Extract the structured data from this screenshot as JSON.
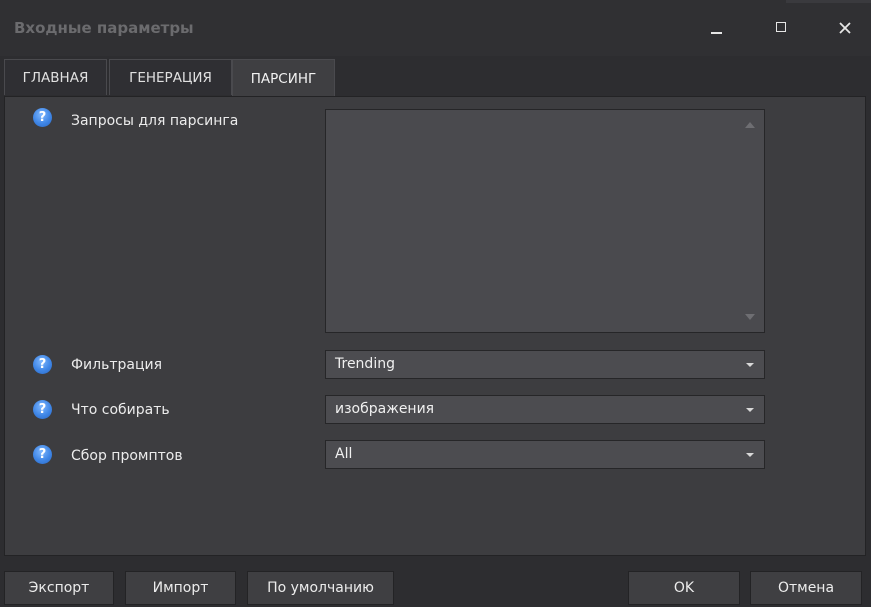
{
  "window": {
    "title": "Входные параметры",
    "controls": [
      "minimize",
      "maximize",
      "close"
    ]
  },
  "tabs": [
    {
      "label": "ГЛАВНАЯ",
      "active": false
    },
    {
      "label": "ГЕНЕРАЦИЯ",
      "active": false
    },
    {
      "label": "ПАРСИНГ",
      "active": true
    }
  ],
  "form": {
    "help_glyph": "?",
    "queries": {
      "label": "Запросы для парсинга",
      "value": ""
    },
    "filter": {
      "label": "Фильтрация",
      "value": "Trending"
    },
    "collect": {
      "label": "Что собирать",
      "value": "изображения"
    },
    "prompts": {
      "label": "Сбор промптов",
      "value": "All"
    }
  },
  "buttons": {
    "export": "Экспорт",
    "import": "Импорт",
    "defaults": "По умолчанию",
    "ok": "OK",
    "cancel": "Отмена"
  },
  "colors": {
    "background": "#2d2d30",
    "panel": "#3d3d40",
    "input": "#4c4c50",
    "help_icon": "#3f86e6"
  }
}
